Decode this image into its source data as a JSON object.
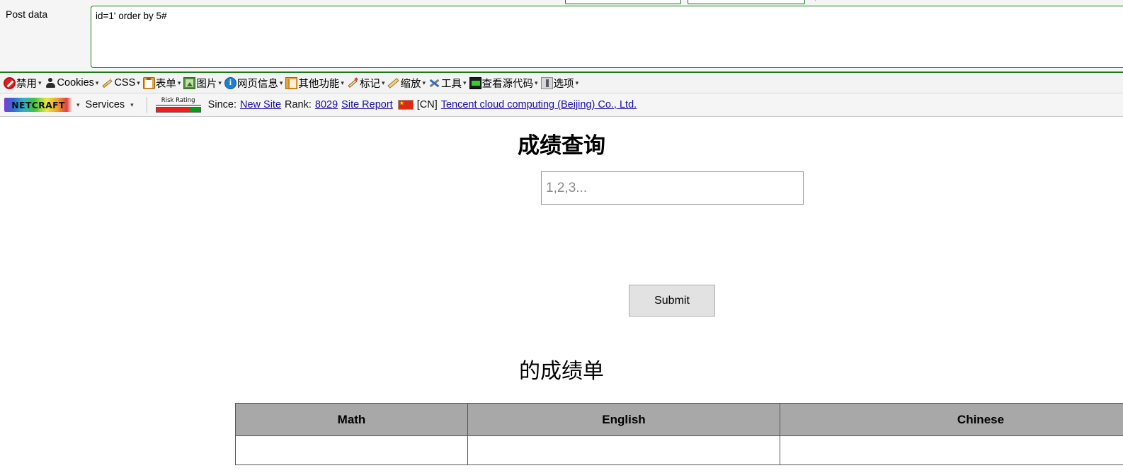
{
  "browser_chrome": {
    "post_data_label": "Post data",
    "post_data_value": "id=1' order by 5#",
    "accent_green": "#1a7a1a"
  },
  "dev_toolbar": {
    "items": [
      {
        "icon": "ban-icon",
        "icon_class": "ic-ban",
        "label": "禁用",
        "caret": "▾"
      },
      {
        "icon": "person-icon",
        "icon_class": "ic-person",
        "label": "Cookies",
        "caret": "▾"
      },
      {
        "icon": "wand-icon",
        "icon_class": "ic-wand",
        "label": "CSS",
        "caret": "▾"
      },
      {
        "icon": "clipboard-icon",
        "icon_class": "ic-clip",
        "label": "表单",
        "caret": "▾"
      },
      {
        "icon": "image-icon",
        "icon_class": "ic-image",
        "label": "图片",
        "caret": "▾"
      },
      {
        "icon": "info-icon",
        "icon_class": "ic-info",
        "label": "网页信息",
        "caret": "▾"
      },
      {
        "icon": "book-icon",
        "icon_class": "ic-book",
        "label": "其他功能",
        "caret": "▾"
      },
      {
        "icon": "pencil-icon",
        "icon_class": "ic-pencil",
        "label": "标记",
        "caret": "▾"
      },
      {
        "icon": "ruler-icon",
        "icon_class": "ic-ruler",
        "label": "缩放",
        "caret": "▾"
      },
      {
        "icon": "tools-icon",
        "icon_class": "ic-tools",
        "label": "工具",
        "caret": "▾"
      },
      {
        "icon": "source-icon",
        "icon_class": "ic-src",
        "label": "查看源代码",
        "caret": "▾"
      },
      {
        "icon": "options-icon",
        "icon_class": "ic-options",
        "label": "选项",
        "caret": "▾"
      }
    ]
  },
  "netcraft_bar": {
    "logo_text": "NETCRAFT",
    "logo_caret": "▾",
    "services_label": "Services",
    "services_caret": "▾",
    "risk_rating_label": "Risk Rating",
    "risk_red_percent": 76,
    "risk_green_percent": 24,
    "since_label": "Since:",
    "since_value": "New Site",
    "rank_label": "Rank:",
    "rank_value": "8029",
    "site_report_label": "Site Report",
    "country_code": "[CN]",
    "flag_name": "china-flag",
    "host_name": "Tencent cloud computing (Beijing) Co., Ltd.",
    "link_color": "#1a0dab"
  },
  "page": {
    "title": "成绩查询",
    "input_placeholder": "1,2,3...",
    "input_value": "",
    "submit_label": "Submit",
    "result_title": "的成绩单",
    "table": {
      "headers": [
        "Math",
        "English",
        "Chinese"
      ],
      "rows": [
        [
          "",
          "",
          ""
        ]
      ],
      "header_bg": "#a8a8a8",
      "border_color": "#555555"
    }
  }
}
